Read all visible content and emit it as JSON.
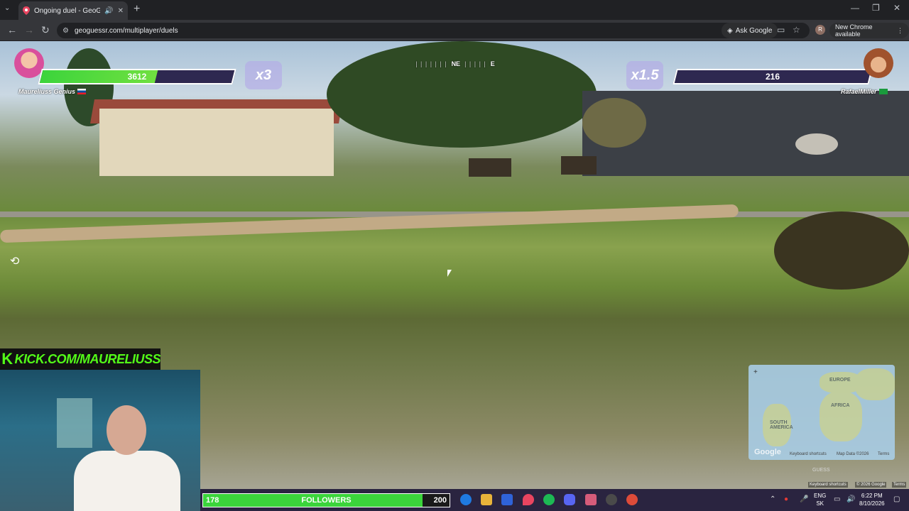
{
  "browser": {
    "tab_title": "Ongoing duel - GeoGuessr",
    "url": "geoguessr.com/multiplayer/duels",
    "ask_google": "Ask Google",
    "profile_initial": "R",
    "new_chrome": "New Chrome available"
  },
  "hud": {
    "player_left": {
      "name": "Maureliuss Genius",
      "health": 3612,
      "health_fraction": 0.6,
      "multiplier": "x3"
    },
    "player_right": {
      "name": "RafaelMiller",
      "health": 216,
      "health_fraction": 0.0,
      "multiplier": "x1.5"
    },
    "compass": {
      "ticks_left": "| | | | | | |",
      "ne": "NE",
      "ticks_right": "| | | | |",
      "e": "E"
    }
  },
  "map": {
    "labels": [
      "EUROPE",
      "AFRICA",
      "SOUTH AMERICA"
    ],
    "logo": "Google",
    "keyboard": "Keyboard shortcuts",
    "mapdata": "Map Data ©2026",
    "terms": "Terms",
    "guess": "GUESS"
  },
  "overlay": {
    "kick_logo": "K",
    "kick_url": "KICK.COM/MAURELIUSS",
    "followers_current": "178",
    "followers_label": "FOLLOWERS",
    "followers_goal": "200",
    "followers_fraction": 0.89
  },
  "streetview_footer": {
    "keyboard": "Keyboard shortcuts",
    "copyright": "© 2026 Google",
    "terms": "Terms"
  },
  "taskbar": {
    "lang_line1": "ENG",
    "lang_line2": "SK",
    "time": "6:22 PM",
    "date": "8/10/2026"
  },
  "colors": {
    "health_green": "#3cd43c",
    "kick_green": "#53fc18",
    "hp_frame": "#2e2850"
  }
}
